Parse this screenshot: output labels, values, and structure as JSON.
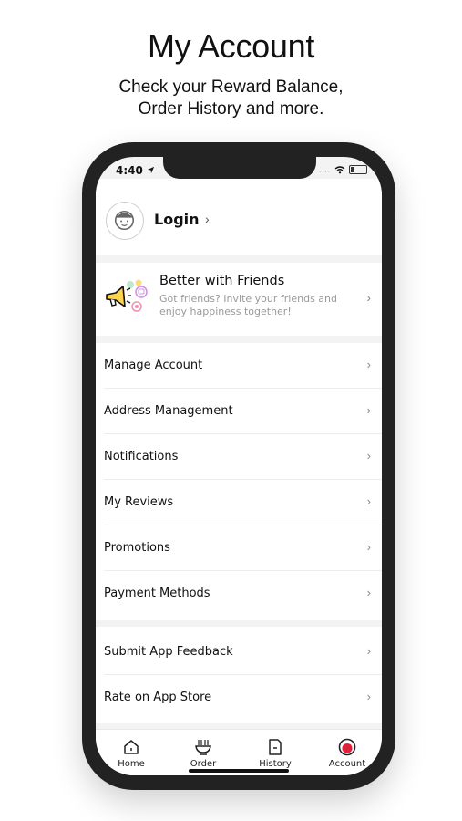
{
  "promo": {
    "title": "My Account",
    "subtitle_line1": "Check your Reward Balance,",
    "subtitle_line2": "Order History and more."
  },
  "status_bar": {
    "time": "4:40",
    "signal": "....",
    "wifi_icon": "wifi-icon",
    "battery_icon": "battery-icon",
    "location_icon": "location-arrow-icon"
  },
  "login": {
    "label": "Login",
    "chevron": "›",
    "avatar_icon": "avatar-face-icon"
  },
  "friends": {
    "title": "Better with Friends",
    "description": "Got friends? Invite your friends and enjoy happiness together!",
    "chevron": "›",
    "icon": "megaphone-icon"
  },
  "menu_group_1": [
    {
      "label": "Manage Account",
      "chevron": "›"
    },
    {
      "label": "Address Management",
      "chevron": "›"
    },
    {
      "label": "Notifications",
      "chevron": "›"
    },
    {
      "label": "My Reviews",
      "chevron": "›"
    },
    {
      "label": "Promotions",
      "chevron": "›"
    },
    {
      "label": "Payment Methods",
      "chevron": "›"
    }
  ],
  "menu_group_2": [
    {
      "label": "Submit App Feedback",
      "chevron": "›"
    },
    {
      "label": "Rate on App Store",
      "chevron": "›"
    }
  ],
  "tabs": [
    {
      "label": "Home",
      "icon": "home-icon"
    },
    {
      "label": "Order",
      "icon": "order-bowl-icon"
    },
    {
      "label": "History",
      "icon": "history-document-icon"
    },
    {
      "label": "Account",
      "icon": "account-icon",
      "active": true
    }
  ],
  "colors": {
    "accent": "#e0203a",
    "phone_frame": "#222222",
    "screen_bg": "#f3f3f3",
    "card_bg": "#ffffff",
    "muted_text": "#9a9a9a"
  }
}
